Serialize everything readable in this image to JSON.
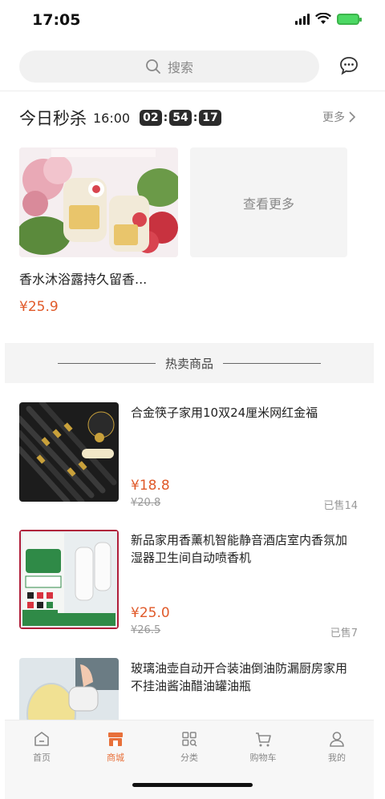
{
  "status_bar": {
    "time": "17:05"
  },
  "header": {
    "search_placeholder": "搜索"
  },
  "flash_sale": {
    "title": "今日秒杀",
    "time": "16:00",
    "countdown": [
      "02",
      "54",
      "17"
    ],
    "more_label": "更多",
    "product": {
      "name": "香水沐浴露持久留香...",
      "price": "¥25.9"
    },
    "see_more_label": "查看更多"
  },
  "hot_section": {
    "title": "热卖商品"
  },
  "products": [
    {
      "name": "合金筷子家用10双24厘米网红金福",
      "price": "¥18.8",
      "original_price": "¥20.8",
      "sold": "已售14"
    },
    {
      "name": "新品家用香薰机智能静音酒店室内香氛加湿器卫生间自动喷香机",
      "price": "¥25.0",
      "original_price": "¥26.5",
      "sold": "已售7"
    },
    {
      "name": "玻璃油壶自动开合装油倒油防漏厨房家用不挂油酱油醋油罐油瓶"
    }
  ],
  "tabs": [
    {
      "label": "首页",
      "icon": "home-icon"
    },
    {
      "label": "商城",
      "icon": "shop-icon",
      "active": true
    },
    {
      "label": "分类",
      "icon": "category-icon"
    },
    {
      "label": "购物车",
      "icon": "cart-icon"
    },
    {
      "label": "我的",
      "icon": "profile-icon"
    }
  ],
  "colors": {
    "accent": "#e05a2a",
    "tab_active": "#e8703a"
  }
}
